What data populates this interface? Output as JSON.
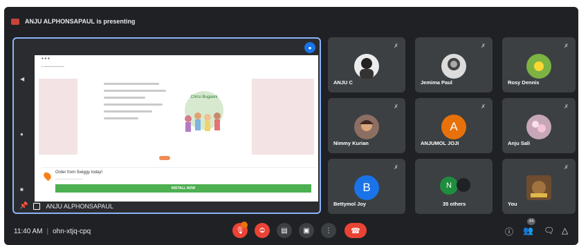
{
  "banner": {
    "text": "ANJU ALPHONSAPAUL is presenting"
  },
  "presentation": {
    "presenter_name": "ANJU ALPHONSAPAUL",
    "ad_title": "Order from Swiggy today!",
    "ad_button": "INSTALL NOW",
    "art_label": "Chrisi Bugaeni"
  },
  "participants": [
    {
      "name": "ANJU C",
      "initial": "",
      "color": "#5f6368"
    },
    {
      "name": "Jemima Paul",
      "initial": "",
      "color": "#5f6368"
    },
    {
      "name": "Rosy Dennis",
      "initial": "",
      "color": "#7cb342"
    },
    {
      "name": "Nimmy Kurian",
      "initial": "",
      "color": "#8d6e63"
    },
    {
      "name": "ANJUMOL JOJI",
      "initial": "A",
      "color": "#e8710a"
    },
    {
      "name": "Anju Sali",
      "initial": "",
      "color": "#c7a6b8"
    },
    {
      "name": "Bettymol Joy",
      "initial": "B",
      "color": "#1a73e8"
    },
    {
      "name": "35 others",
      "initial": "N",
      "color": "#1e8e3e"
    },
    {
      "name": "You",
      "initial": "",
      "color": "#6d4c2f"
    }
  ],
  "footer": {
    "time": "11:40 AM",
    "meeting_code": "ohn-xtjq-cpq"
  },
  "colors": {
    "accent": "#8ab4f8",
    "end_call": "#ea4335",
    "tile_bg": "#3c4043",
    "bg": "#202124"
  }
}
